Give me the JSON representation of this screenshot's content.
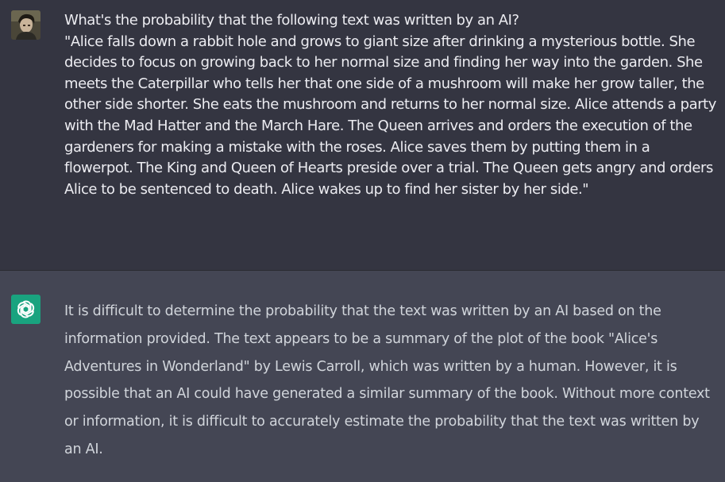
{
  "conversation": {
    "user_message": {
      "avatar": "user-photo-avatar",
      "text": "What's the probability that the following text was written by an AI?\n\"Alice falls down a rabbit hole and grows to giant size after drinking a mysterious bottle. She decides to focus on growing back to her normal size and finding her way into the garden. She meets the Caterpillar who tells her that one side of a mushroom will make her grow taller, the other side shorter. She eats the mushroom and returns to her normal size. Alice attends a party with the Mad Hatter and the March Hare. The Queen arrives and orders the execution of the gardeners for making a mistake with the roses. Alice saves them by putting them in a flowerpot. The King and Queen of Hearts preside over a trial. The Queen gets angry and orders Alice to be sentenced to death. Alice wakes up to find her sister by her side.\""
    },
    "assistant_message": {
      "avatar": "openai-logo-icon",
      "text": "It is difficult to determine the probability that the text was written by an AI based on the information provided. The text appears to be a summary of the plot of the book \"Alice's Adventures in Wonderland\" by Lewis Carroll, which was written by a human. However, it is possible that an AI could have generated a similar summary of the book. Without more context or information, it is difficult to accurately estimate the probability that the text was written by an AI."
    }
  },
  "colors": {
    "user_bg": "#343541",
    "assistant_bg": "#444654",
    "user_text": "#ececf1",
    "assistant_text": "#d1d5db",
    "bot_avatar_bg": "#19a37f"
  }
}
